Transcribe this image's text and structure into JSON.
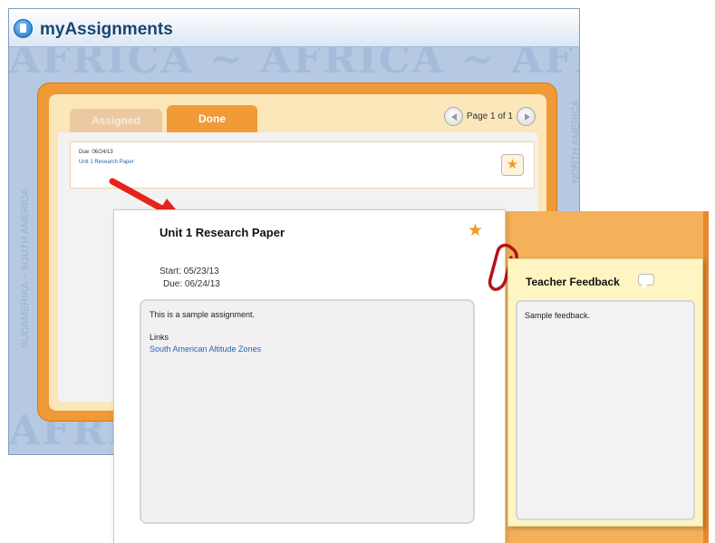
{
  "app": {
    "title": "myAssignments"
  },
  "watermark": {
    "top": "AFRICA  ~ AFRICA  ~ AFRICA  ~ AF",
    "bottom": "AFRIKA"
  },
  "side_text": {
    "left": "SUDAMERIKA ~ SOUTH AMERICA",
    "right": "NORTH AMERICA"
  },
  "tabs": [
    {
      "label": "Assigned"
    },
    {
      "label": "Done"
    }
  ],
  "pager": {
    "text": "Page 1 of 1"
  },
  "list": [
    {
      "due": "Due: 06/24/13",
      "title": "Unit 1 Research Paper"
    }
  ],
  "detail": {
    "title": "Unit 1 Research Paper",
    "start": "Start: 05/23/13",
    "due": "Due: 06/24/13",
    "description": "This is a sample assignment.",
    "links_label": "Links",
    "links": [
      "South American Altitude Zones"
    ]
  },
  "feedback": {
    "title": "Teacher Feedback",
    "text": "Sample feedback."
  },
  "colors": {
    "accent_orange": "#f09a38",
    "link_blue": "#2a62b8",
    "star": "#f29b1d",
    "arrow": "#e8231c"
  },
  "icons": [
    "app-logo-icon",
    "chevron-left-icon",
    "chevron-right-icon",
    "star-icon",
    "speech-bubble-icon",
    "paperclip-icon",
    "red-arrow-icon"
  ]
}
